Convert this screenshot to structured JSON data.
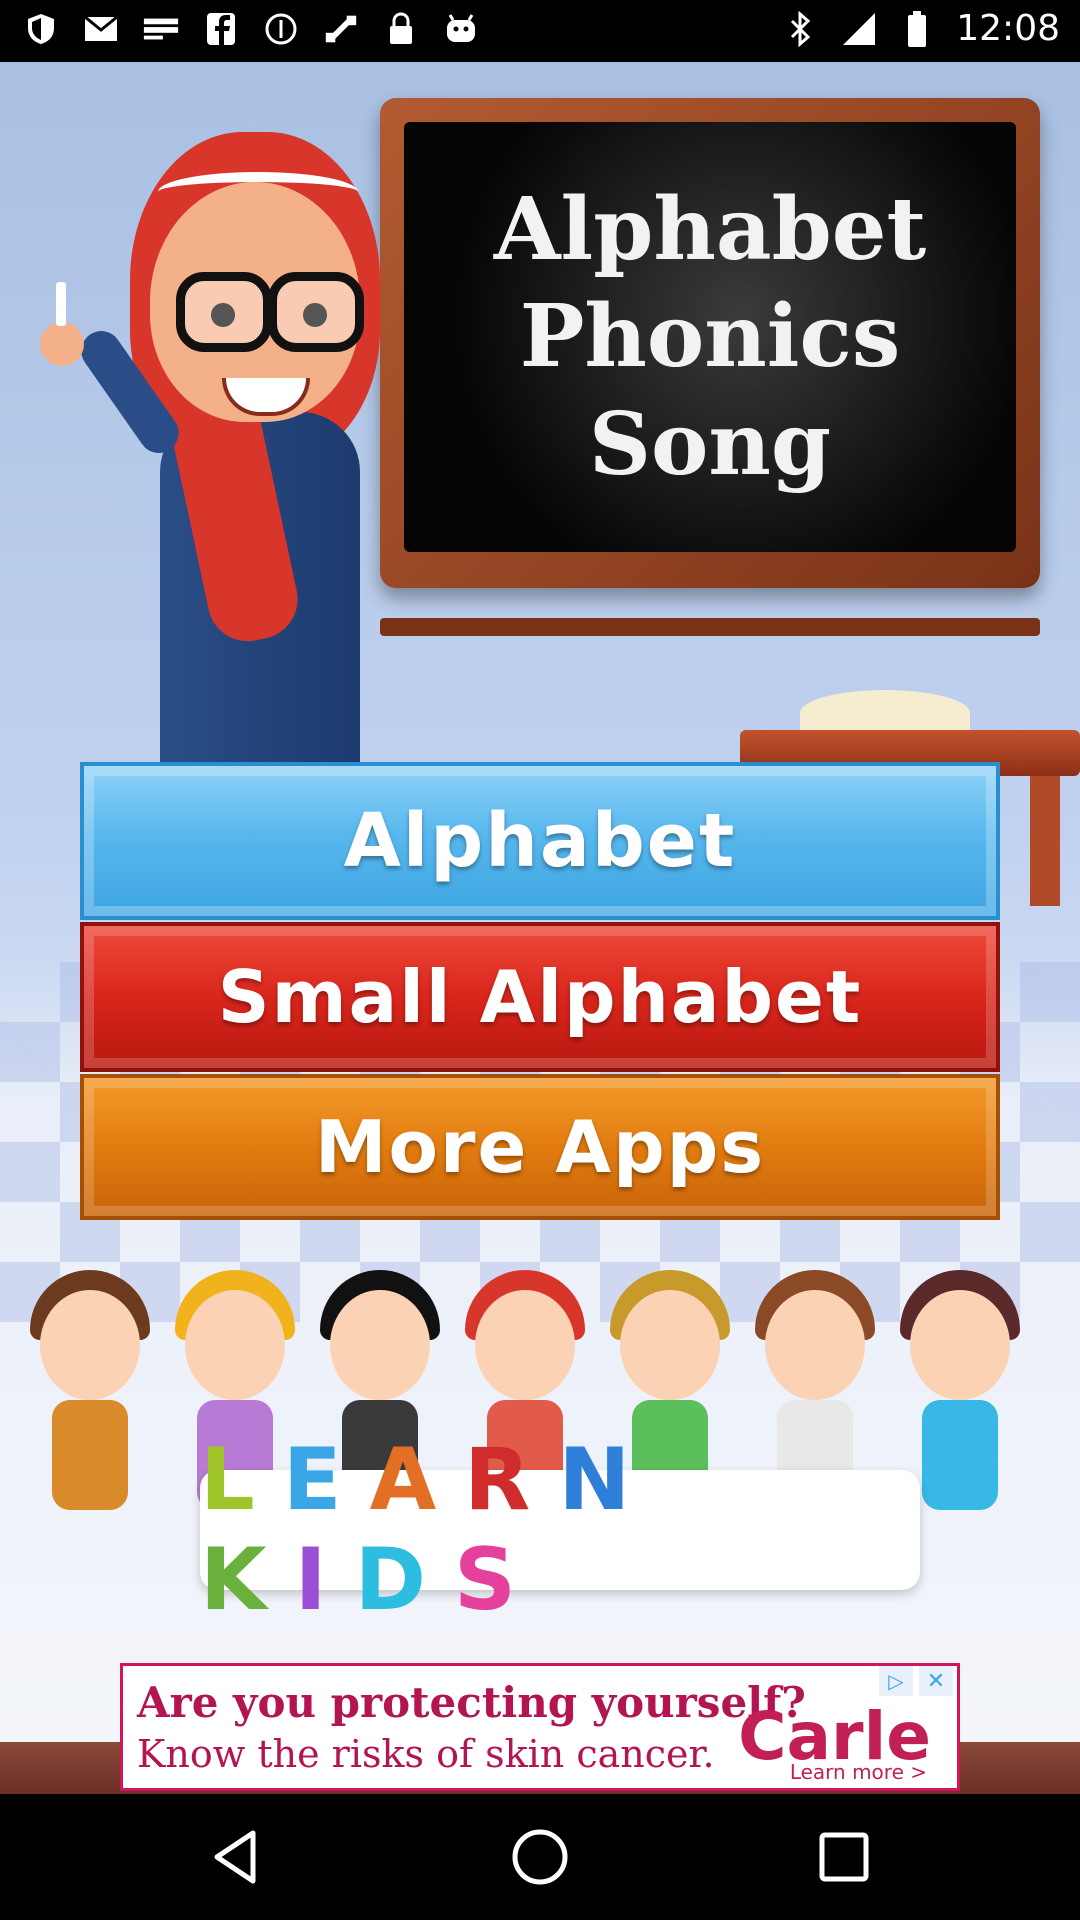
{
  "status_bar": {
    "time": "12:08",
    "left_icons": [
      "shield-icon",
      "gmail-icon",
      "espn-dallas-icon",
      "facebook-icon",
      "cancel-circle-icon",
      "fake-gps-icon",
      "lock-icon",
      "android-icon"
    ],
    "right_icons": [
      "bluetooth-icon",
      "signal-icon",
      "battery-icon"
    ]
  },
  "hero": {
    "board_lines": [
      "Alphabet",
      "Phonics",
      "Song"
    ]
  },
  "menu": {
    "alphabet_label": "Alphabet",
    "small_alphabet_label": "Small Alphabet",
    "more_apps_label": "More Apps",
    "colors": {
      "blue": "#58b8ee",
      "red": "#d9261c",
      "orange": "#e27c10"
    }
  },
  "banner": {
    "letters": [
      "L",
      "E",
      "A",
      "R",
      "N",
      " ",
      "K",
      "I",
      "D",
      "S"
    ]
  },
  "ad": {
    "line1": "Are you protecting yourself?",
    "line2": "Know the risks of skin cancer.",
    "brand": "Carle",
    "cta": "Learn more >",
    "accent": "#d4145a"
  },
  "nav_bar": {
    "buttons": [
      "back-icon",
      "home-icon",
      "recents-icon"
    ]
  }
}
